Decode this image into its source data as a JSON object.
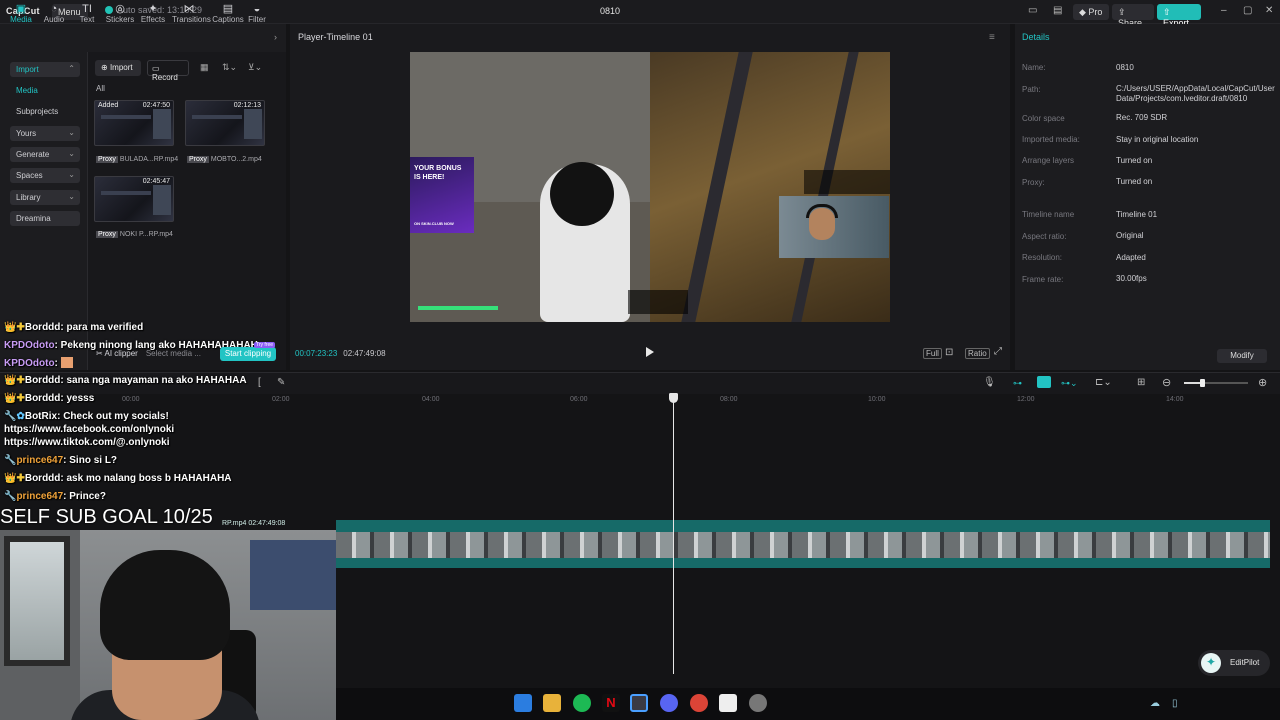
{
  "titlebar": {
    "logo": "CapCut",
    "menu": "Menu",
    "autosave": "Auto saved: 13:10:29",
    "project": "0810",
    "pro": "Pro",
    "share": "Share",
    "export": "Export"
  },
  "tools": [
    {
      "icon": "▣",
      "label": "Media"
    },
    {
      "icon": "◔",
      "label": "Audio"
    },
    {
      "icon": "TI",
      "label": "Text"
    },
    {
      "icon": "◎",
      "label": "Stickers"
    },
    {
      "icon": "✦",
      "label": "Effects"
    },
    {
      "icon": "⋈",
      "label": "Transitions"
    },
    {
      "icon": "▤",
      "label": "Captions"
    },
    {
      "icon": "◒",
      "label": "Filter"
    }
  ],
  "sidebar": {
    "items": [
      "Import",
      "Media",
      "Subprojects",
      "Yours",
      "Generate",
      "Spaces",
      "Library",
      "Dreamina"
    ]
  },
  "media": {
    "import": "Import",
    "record": "Record",
    "all": "All",
    "clips": [
      {
        "tag": "Added",
        "time": "02:47:50",
        "proxy": "Proxy",
        "name": "BULADA...RP.mp4"
      },
      {
        "tag": "",
        "time": "02:12:13",
        "proxy": "Proxy",
        "name": "MOBTO...2.mp4"
      },
      {
        "tag": "",
        "time": "02:45:47",
        "proxy": "Proxy",
        "name": "NOKI P...RP.mp4"
      }
    ]
  },
  "clipper": {
    "label": "AI clipper",
    "select": "Select media ...",
    "button": "Start clipping",
    "badge": "Try free"
  },
  "player": {
    "title": "Player-Timeline 01",
    "current": "00:07:23:23",
    "total": "02:47:49:08",
    "full": "Full",
    "ratio": "Ratio",
    "ad_line1": "YOUR BONUS",
    "ad_line2": "IS HERE!",
    "ad_line3": "ON SKIN.CLUB NOW"
  },
  "details": {
    "title": "Details",
    "rows": [
      {
        "k": "Name:",
        "v": "0810"
      },
      {
        "k": "Path:",
        "v": "C:/Users/USER/AppData/Local/CapCut/User Data/Projects/com.lveditor.draft/0810"
      },
      {
        "k": "Color space",
        "v": "Rec. 709 SDR"
      },
      {
        "k": "Imported media:",
        "v": "Stay in original location"
      },
      {
        "k": "Arrange layers",
        "v": "Turned on"
      },
      {
        "k": "Proxy:",
        "v": "Turned on"
      },
      {
        "k": "Timeline name",
        "v": "Timeline 01"
      },
      {
        "k": "Aspect ratio:",
        "v": "Original"
      },
      {
        "k": "Resolution:",
        "v": "Adapted"
      },
      {
        "k": "Frame rate:",
        "v": "30.00fps"
      }
    ],
    "modify": "Modify"
  },
  "timeline": {
    "ticks": [
      "00:00",
      "02:00",
      "04:00",
      "06:00",
      "08:00",
      "10:00",
      "12:00",
      "14:00"
    ],
    "clip_label": "RP.mp4",
    "clip_time": "02:47:49:08",
    "editpilot": "EditPilot"
  },
  "chat": [
    {
      "user": "Borddd",
      "msg": "para ma verified",
      "color": "white",
      "badge": "👑✚"
    },
    {
      "user": "KPDOdoto",
      "msg": "Pekeng ninong lang ako HAHAHAHAHAH",
      "color": "purple",
      "badge": ""
    },
    {
      "user": "KPDOdoto",
      "msg": "",
      "color": "purple",
      "badge": ""
    },
    {
      "user": "Borddd",
      "msg": "sana nga mayaman na ako HAHAHAA",
      "color": "white",
      "badge": "👑✚"
    },
    {
      "user": "Borddd",
      "msg": "yesss",
      "color": "white",
      "badge": "👑✚"
    },
    {
      "user": "BotRix",
      "msg": "Check out my socials!",
      "color": "white",
      "badge": "🔧✿"
    },
    {
      "user": "",
      "msg": "https://www.facebook.com/onlynoki",
      "color": "white",
      "badge": ""
    },
    {
      "user": "",
      "msg": "https://www.tiktok.com/@.onlynoki",
      "color": "white",
      "badge": ""
    },
    {
      "user": "prince647",
      "msg": "Sino si L?",
      "color": "orange",
      "badge": "🔧"
    },
    {
      "user": "Borddd",
      "msg": "ask mo nalang boss b HAHAHAHA",
      "color": "white",
      "badge": "👑✚"
    },
    {
      "user": "prince647",
      "msg": "Prince?",
      "color": "orange",
      "badge": "🔧"
    }
  ],
  "overlay": {
    "subgoal": "SELF SUB GOAL 10/25"
  },
  "colors": {
    "accent": "#22c4c4",
    "track": "#166a68",
    "export": "#21bdb7"
  }
}
